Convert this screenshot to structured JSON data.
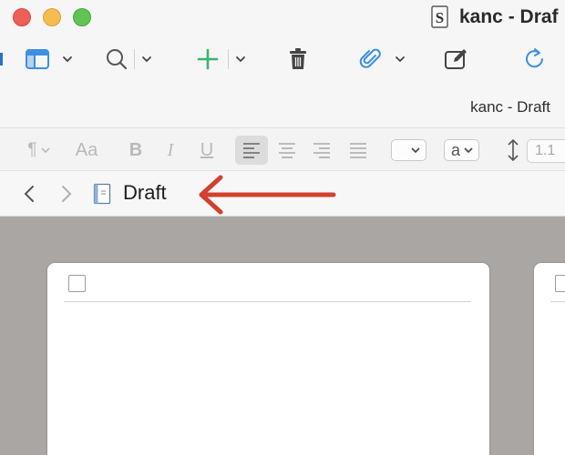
{
  "window": {
    "title": "kanc - Draf",
    "subtitle": "kanc - Draft"
  },
  "toolbar": {
    "items": [
      {
        "name": "sidebar",
        "icon": "sidebar-icon"
      },
      {
        "name": "search",
        "icon": "search-icon"
      },
      {
        "name": "add",
        "icon": "plus-icon"
      },
      {
        "name": "delete",
        "icon": "trash-icon"
      },
      {
        "name": "attach",
        "icon": "paperclip-icon"
      },
      {
        "name": "compose",
        "icon": "compose-icon"
      },
      {
        "name": "sync",
        "icon": "sync-icon"
      }
    ]
  },
  "formatbar": {
    "font_size_label": "Aa",
    "bold_label": "B",
    "italic_label": "I",
    "underline_label": "U",
    "text_style_value": "a",
    "line_spacing_value": "1.1",
    "alignment_selected": "left"
  },
  "nav": {
    "breadcrumb_label": "Draft"
  },
  "annotation": {
    "arrow_color": "#d2402f"
  },
  "colors": {
    "close": "#ee5f57",
    "minimize": "#f5bd4f",
    "maximize": "#5fc454",
    "accent_blue": "#3d8fe0",
    "accent_green": "#3cb36a",
    "canvas": "#a9a6a4"
  }
}
